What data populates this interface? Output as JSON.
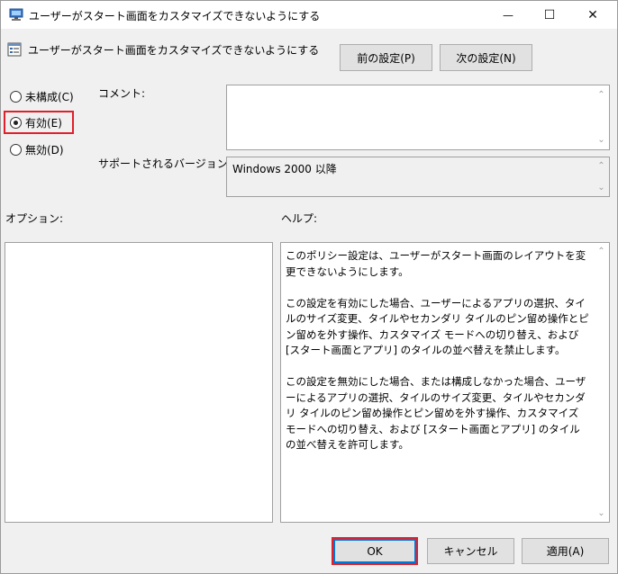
{
  "window": {
    "title": "ユーザーがスタート画面をカスタマイズできないようにする",
    "minimize_glyph": "—",
    "maximize_glyph": "☐",
    "close_glyph": "✕"
  },
  "header": {
    "policy_name": "ユーザーがスタート画面をカスタマイズできないようにする",
    "prev_button": "前の設定(P)",
    "next_button": "次の設定(N)"
  },
  "state_options": [
    {
      "label": "未構成(C)",
      "selected": false
    },
    {
      "label": "有効(E)",
      "selected": true
    },
    {
      "label": "無効(D)",
      "selected": false
    }
  ],
  "comment": {
    "label": "コメント:",
    "value": ""
  },
  "supported": {
    "label": "サポートされるバージョン:",
    "value": "Windows 2000 以降"
  },
  "options": {
    "label": "オプション:"
  },
  "help": {
    "label": "ヘルプ:",
    "text": "このポリシー設定は、ユーザーがスタート画面のレイアウトを変更できないようにします。\n\nこの設定を有効にした場合、ユーザーによるアプリの選択、タイルのサイズ変更、タイルやセカンダリ タイルのピン留め操作とピン留めを外す操作、カスタマイズ モードへの切り替え、および [スタート画面とアプリ] のタイルの並べ替えを禁止します。\n\nこの設定を無効にした場合、または構成しなかった場合、ユーザーによるアプリの選択、タイルのサイズ変更、タイルやセカンダリ タイルのピン留め操作とピン留めを外す操作、カスタマイズ モードへの切り替え、および [スタート画面とアプリ] のタイルの並べ替えを許可します。"
  },
  "footer": {
    "ok": "OK",
    "cancel": "キャンセル",
    "apply": "適用(A)"
  },
  "colors": {
    "highlight": "#e0202a",
    "focus": "#0078d7"
  }
}
